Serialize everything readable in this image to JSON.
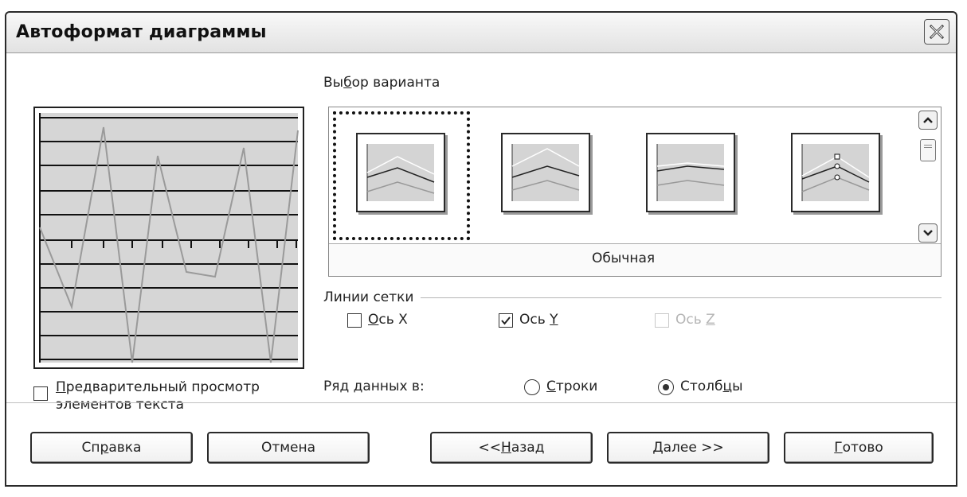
{
  "window": {
    "title": "Автоформат диаграммы",
    "close_icon": "close-icon"
  },
  "variants": {
    "section_label_pre": "Вы",
    "section_label_key": "б",
    "section_label_post": "ор варианта",
    "selected_name": "Обычная",
    "items": [
      "variant-1",
      "variant-2",
      "variant-3",
      "variant-4"
    ]
  },
  "preview_checkbox": {
    "line1_key": "П",
    "line1_rest": "редварительный просмотр",
    "line2": "элементов текста",
    "checked": false
  },
  "grid_lines": {
    "label": "Линии сетки",
    "axis_x": {
      "key": "О",
      "rest": "сь X",
      "checked": false,
      "enabled": true
    },
    "axis_y": {
      "pre": "Ось ",
      "key": "Y",
      "checked": true,
      "enabled": true
    },
    "axis_z": {
      "pre": "Ось ",
      "key": "Z",
      "checked": false,
      "enabled": false
    }
  },
  "data_series": {
    "label": "Ряд данных в:",
    "rows": {
      "key": "С",
      "rest": "троки",
      "selected": false
    },
    "columns": {
      "pre": "Столб",
      "key": "ц",
      "post": "ы",
      "selected": true
    }
  },
  "buttons": {
    "help": {
      "pre": "Сп",
      "key": "р",
      "post": "авка"
    },
    "cancel": "Отмена",
    "back": {
      "pre": "<< ",
      "key": "Н",
      "post": "азад"
    },
    "next": {
      "key": "Д",
      "post": "алее >>"
    },
    "finish": {
      "key": "Г",
      "post": "отово"
    }
  },
  "colors": {
    "text": "#222222",
    "disabled": "#b5b5b5",
    "thumb_bg": "#d4d4d4"
  }
}
